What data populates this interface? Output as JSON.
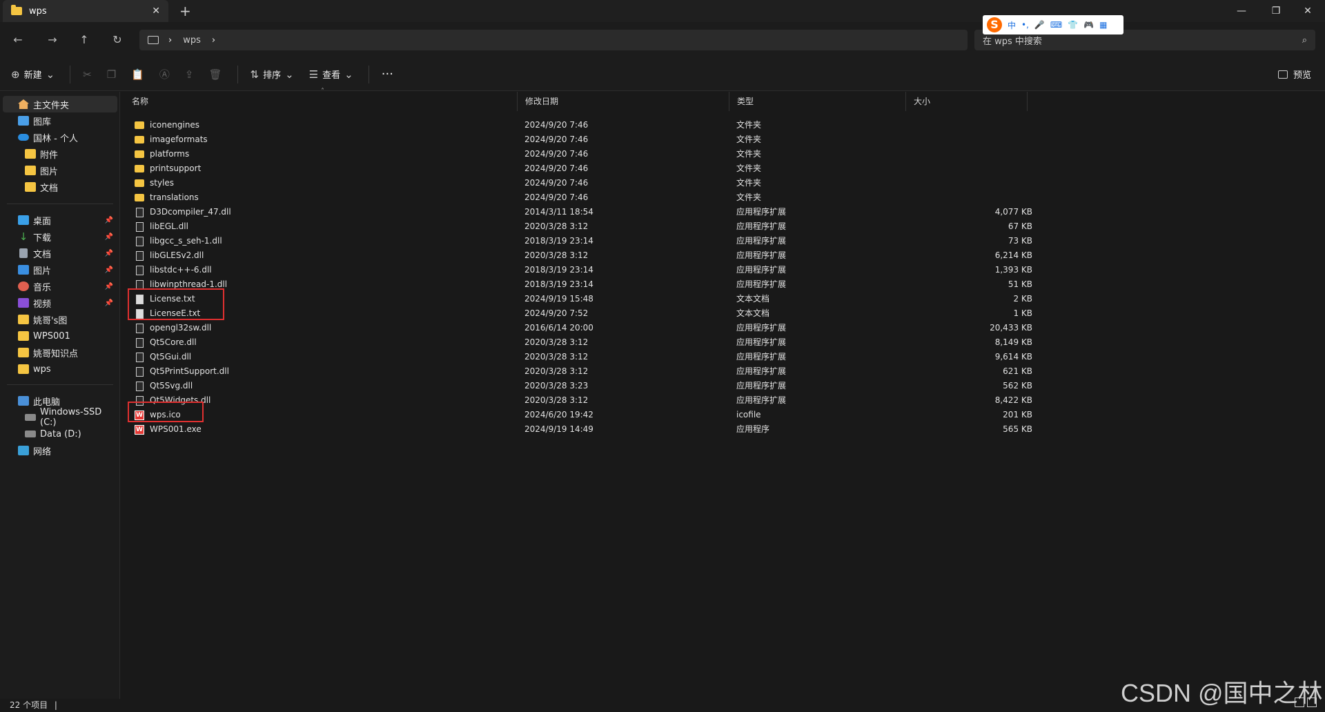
{
  "window": {
    "tab_title": "wps",
    "new_tab": "+",
    "minimize": "—",
    "maximize": "❐",
    "close": "✕"
  },
  "address": {
    "path_segment": "wps",
    "search_placeholder": "在 wps 中搜索"
  },
  "ime": {
    "logo": "S",
    "mode": "中",
    "punct": "•,"
  },
  "toolbar": {
    "new_label": "新建",
    "sort_label": "排序",
    "view_label": "查看",
    "more_label": "···",
    "preview_label": "预览"
  },
  "sidebar": {
    "quick": [
      {
        "label": "主文件夹",
        "icon": "home-icon"
      },
      {
        "label": "图库",
        "icon": "gallery-icon"
      },
      {
        "label": "国林 - 个人",
        "icon": "cloud-icon"
      },
      {
        "label": "附件",
        "icon": "folder-icon"
      },
      {
        "label": "图片",
        "icon": "folder-icon"
      },
      {
        "label": "文档",
        "icon": "folder-icon"
      }
    ],
    "pinned": [
      {
        "label": "桌面",
        "icon": "desktop-icon"
      },
      {
        "label": "下载",
        "icon": "download-icon"
      },
      {
        "label": "文档",
        "icon": "document-icon"
      },
      {
        "label": "图片",
        "icon": "picture-icon"
      },
      {
        "label": "音乐",
        "icon": "music-icon"
      },
      {
        "label": "视频",
        "icon": "video-icon"
      },
      {
        "label": "姚哥's图",
        "icon": "folder-icon"
      },
      {
        "label": "WPS001",
        "icon": "folder-icon"
      },
      {
        "label": "姚哥知识点",
        "icon": "folder-icon"
      },
      {
        "label": "wps",
        "icon": "folder-icon"
      }
    ],
    "devices": [
      {
        "label": "此电脑",
        "icon": "pc-icon"
      },
      {
        "label": "Windows-SSD (C:)",
        "icon": "drive-icon"
      },
      {
        "label": "Data (D:)",
        "icon": "drive-icon"
      },
      {
        "label": "网络",
        "icon": "network-icon"
      }
    ]
  },
  "columns": {
    "name": "名称",
    "date": "修改日期",
    "type": "类型",
    "size": "大小"
  },
  "files": [
    {
      "name": "iconengines",
      "date": "2024/9/20 7:46",
      "type": "文件夹",
      "size": "",
      "kind": "folder"
    },
    {
      "name": "imageformats",
      "date": "2024/9/20 7:46",
      "type": "文件夹",
      "size": "",
      "kind": "folder"
    },
    {
      "name": "platforms",
      "date": "2024/9/20 7:46",
      "type": "文件夹",
      "size": "",
      "kind": "folder"
    },
    {
      "name": "printsupport",
      "date": "2024/9/20 7:46",
      "type": "文件夹",
      "size": "",
      "kind": "folder"
    },
    {
      "name": "styles",
      "date": "2024/9/20 7:46",
      "type": "文件夹",
      "size": "",
      "kind": "folder"
    },
    {
      "name": "translations",
      "date": "2024/9/20 7:46",
      "type": "文件夹",
      "size": "",
      "kind": "folder"
    },
    {
      "name": "D3Dcompiler_47.dll",
      "date": "2014/3/11 18:54",
      "type": "应用程序扩展",
      "size": "4,077 KB",
      "kind": "file"
    },
    {
      "name": "libEGL.dll",
      "date": "2020/3/28 3:12",
      "type": "应用程序扩展",
      "size": "67 KB",
      "kind": "file"
    },
    {
      "name": "libgcc_s_seh-1.dll",
      "date": "2018/3/19 23:14",
      "type": "应用程序扩展",
      "size": "73 KB",
      "kind": "file"
    },
    {
      "name": "libGLESv2.dll",
      "date": "2020/3/28 3:12",
      "type": "应用程序扩展",
      "size": "6,214 KB",
      "kind": "file"
    },
    {
      "name": "libstdc++-6.dll",
      "date": "2018/3/19 23:14",
      "type": "应用程序扩展",
      "size": "1,393 KB",
      "kind": "file"
    },
    {
      "name": "libwinpthread-1.dll",
      "date": "2018/3/19 23:14",
      "type": "应用程序扩展",
      "size": "51 KB",
      "kind": "file"
    },
    {
      "name": "License.txt",
      "date": "2024/9/19 15:48",
      "type": "文本文档",
      "size": "2 KB",
      "kind": "text"
    },
    {
      "name": "LicenseE.txt",
      "date": "2024/9/20 7:52",
      "type": "文本文档",
      "size": "1 KB",
      "kind": "text"
    },
    {
      "name": "opengl32sw.dll",
      "date": "2016/6/14 20:00",
      "type": "应用程序扩展",
      "size": "20,433 KB",
      "kind": "file"
    },
    {
      "name": "Qt5Core.dll",
      "date": "2020/3/28 3:12",
      "type": "应用程序扩展",
      "size": "8,149 KB",
      "kind": "file"
    },
    {
      "name": "Qt5Gui.dll",
      "date": "2020/3/28 3:12",
      "type": "应用程序扩展",
      "size": "9,614 KB",
      "kind": "file"
    },
    {
      "name": "Qt5PrintSupport.dll",
      "date": "2020/3/28 3:12",
      "type": "应用程序扩展",
      "size": "621 KB",
      "kind": "file"
    },
    {
      "name": "Qt5Svg.dll",
      "date": "2020/3/28 3:23",
      "type": "应用程序扩展",
      "size": "562 KB",
      "kind": "file"
    },
    {
      "name": "Qt5Widgets.dll",
      "date": "2020/3/28 3:12",
      "type": "应用程序扩展",
      "size": "8,422 KB",
      "kind": "file"
    },
    {
      "name": "wps.ico",
      "date": "2024/6/20 19:42",
      "type": "icofile",
      "size": "201 KB",
      "kind": "wps"
    },
    {
      "name": "WPS001.exe",
      "date": "2024/9/19 14:49",
      "type": "应用程序",
      "size": "565 KB",
      "kind": "wps"
    }
  ],
  "status": {
    "item_count": "22 个项目"
  },
  "watermark": "CSDN @国中之林",
  "colors": {
    "background": "#191919",
    "accent_folder": "#f5c542",
    "highlight_box": "#e03030"
  }
}
